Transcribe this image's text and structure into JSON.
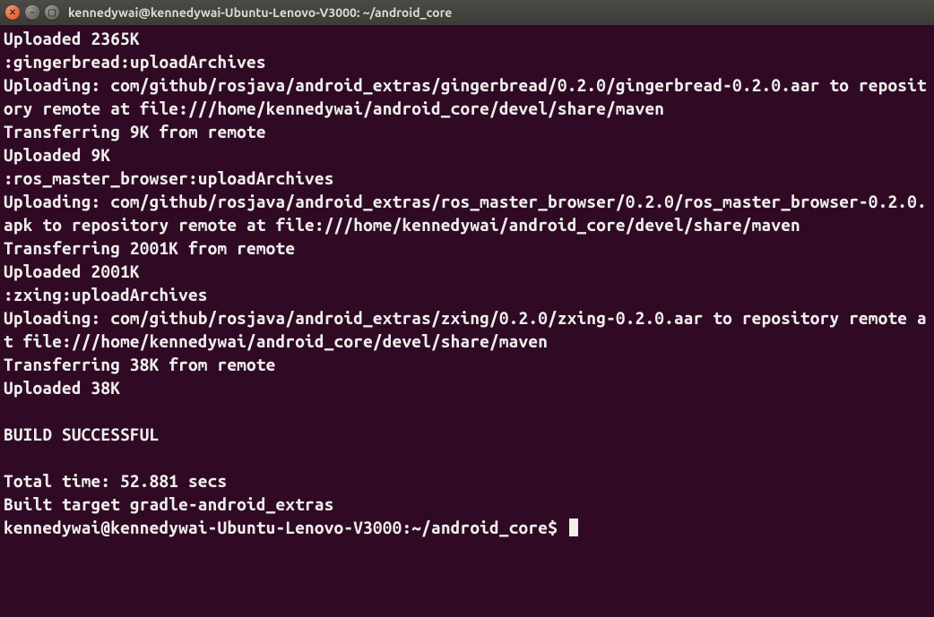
{
  "window": {
    "title": "kennedywai@kennedywai-Ubuntu-Lenovo-V3000: ~/android_core"
  },
  "terminal": {
    "lines": [
      "Uploaded 2365K",
      ":gingerbread:uploadArchives",
      "Uploading: com/github/rosjava/android_extras/gingerbread/0.2.0/gingerbread-0.2.0.aar to repository remote at file:///home/kennedywai/android_core/devel/share/maven",
      "Transferring 9K from remote",
      "Uploaded 9K",
      ":ros_master_browser:uploadArchives",
      "Uploading: com/github/rosjava/android_extras/ros_master_browser/0.2.0/ros_master_browser-0.2.0.apk to repository remote at file:///home/kennedywai/android_core/devel/share/maven",
      "Transferring 2001K from remote",
      "Uploaded 2001K",
      ":zxing:uploadArchives",
      "Uploading: com/github/rosjava/android_extras/zxing/0.2.0/zxing-0.2.0.aar to repository remote at file:///home/kennedywai/android_core/devel/share/maven",
      "Transferring 38K from remote",
      "Uploaded 38K",
      "",
      "BUILD SUCCESSFUL",
      "",
      "Total time: 52.881 secs",
      "Built target gradle-android_extras"
    ],
    "prompt": {
      "user_host": "kennedywai@kennedywai-Ubuntu-Lenovo-V3000",
      "separator": ":",
      "path": "~/android_core",
      "symbol": "$"
    }
  }
}
